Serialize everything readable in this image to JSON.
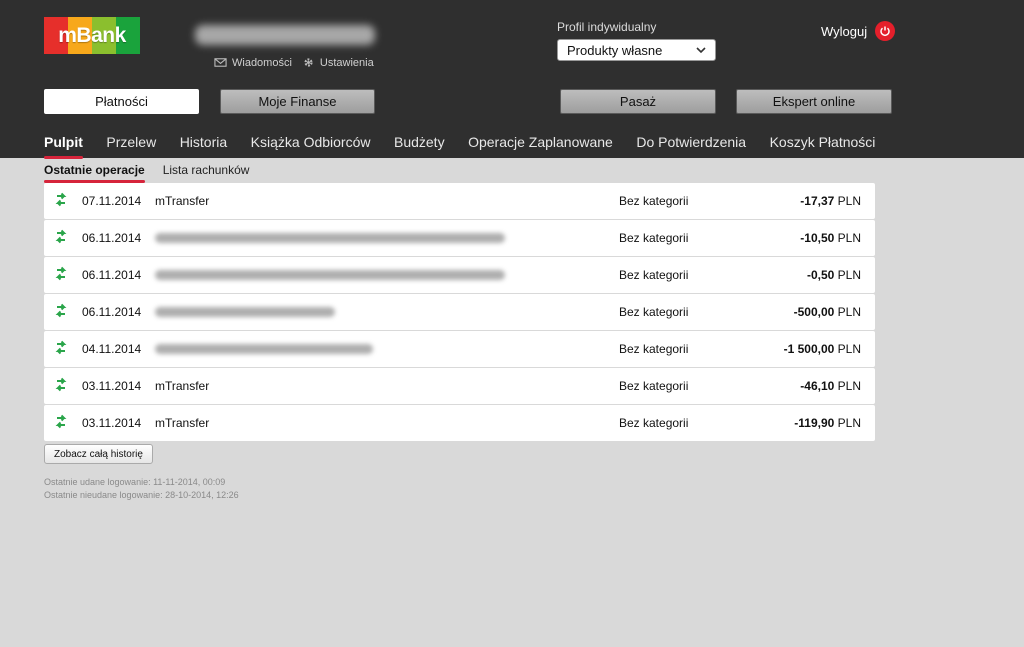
{
  "colors": {
    "accent": "#d6243b",
    "logout": "#e41f2b",
    "logo_segments": [
      "#e62f2b",
      "#f7a81b",
      "#8bbf2e",
      "#1aa33c"
    ],
    "icon_green": "#2aa54a"
  },
  "header": {
    "logo_text": "mBank",
    "links": [
      {
        "label": "Wiadomości",
        "icon": "mail-icon"
      },
      {
        "label": "Ustawienia",
        "icon": "gear-icon"
      }
    ],
    "profile_label": "Profil indywidualny",
    "profile_value": "Produkty własne",
    "logout_label": "Wyloguj"
  },
  "top_buttons": [
    {
      "label": "Płatności",
      "active": true
    },
    {
      "label": "Moje Finanse",
      "active": false
    },
    {
      "label": "Pasaż",
      "active": false
    },
    {
      "label": "Ekspert online",
      "active": false
    }
  ],
  "nav": [
    {
      "label": "Pulpit",
      "active": true
    },
    {
      "label": "Przelew"
    },
    {
      "label": "Historia"
    },
    {
      "label": "Książka Odbiorców"
    },
    {
      "label": "Budżety"
    },
    {
      "label": "Operacje Zaplanowane"
    },
    {
      "label": "Do Potwierdzenia"
    },
    {
      "label": "Koszyk Płatności"
    }
  ],
  "subnav": [
    {
      "label": "Ostatnie operacje",
      "active": true
    },
    {
      "label": "Lista rachunków"
    }
  ],
  "operations": [
    {
      "date": "07.11.2014",
      "desc": "mTransfer",
      "category": "Bez kategorii",
      "amount": "-17,37",
      "currency": "PLN"
    },
    {
      "date": "06.11.2014",
      "desc": "",
      "category": "Bez kategorii",
      "amount": "-10,50",
      "currency": "PLN"
    },
    {
      "date": "06.11.2014",
      "desc": "",
      "category": "Bez kategorii",
      "amount": "-0,50",
      "currency": "PLN"
    },
    {
      "date": "06.11.2014",
      "desc": "",
      "category": "Bez kategorii",
      "amount": "-500,00",
      "currency": "PLN"
    },
    {
      "date": "04.11.2014",
      "desc": "",
      "category": "Bez kategorii",
      "amount": "-1 500,00",
      "currency": "PLN"
    },
    {
      "date": "03.11.2014",
      "desc": "mTransfer",
      "category": "Bez kategorii",
      "amount": "-46,10",
      "currency": "PLN"
    },
    {
      "date": "03.11.2014",
      "desc": "mTransfer",
      "category": "Bez kategorii",
      "amount": "-119,90",
      "currency": "PLN"
    }
  ],
  "history_button": "Zobacz całą historię",
  "logins": {
    "last_success": "Ostatnie udane logowanie: 11-11-2014, 00:09",
    "last_failed": "Ostatnie nieudane logowanie: 28-10-2014, 12:26"
  }
}
